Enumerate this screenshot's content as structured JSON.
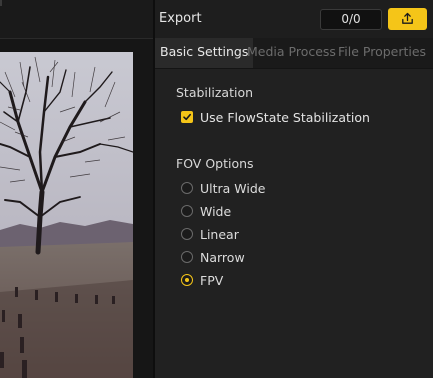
{
  "export": {
    "title": "Export",
    "counter": "0/0",
    "button_icon": "export-upload-icon",
    "accent_color": "#f5c518"
  },
  "tabs": [
    {
      "label": "Basic Settings",
      "active": true
    },
    {
      "label": "Media Process",
      "active": false
    },
    {
      "label": "File Properties",
      "active": false
    }
  ],
  "stabilization": {
    "title": "Stabilization",
    "checkbox_label": "Use FlowState Stabilization",
    "checked": true
  },
  "fov": {
    "title": "FOV Options",
    "options": [
      {
        "label": "Ultra Wide",
        "selected": false
      },
      {
        "label": "Wide",
        "selected": false
      },
      {
        "label": "Linear",
        "selected": false
      },
      {
        "label": "Narrow",
        "selected": false
      },
      {
        "label": "FPV",
        "selected": true
      }
    ]
  }
}
